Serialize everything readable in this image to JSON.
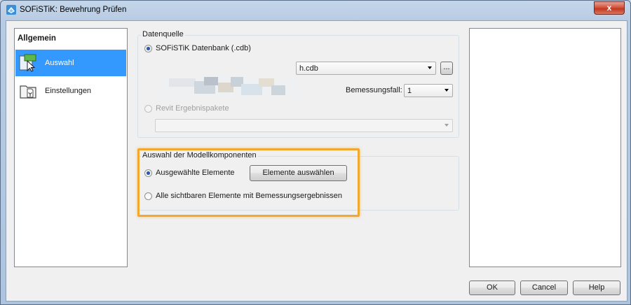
{
  "window": {
    "title": "SOFiSTiK: Bewehrung Prüfen",
    "close_label": "x"
  },
  "nav": {
    "header": "Allgemein",
    "items": [
      {
        "label": "Auswahl",
        "selected": true,
        "icon": "selection-icon"
      },
      {
        "label": "Einstellungen",
        "selected": false,
        "icon": "settings-folder-icon"
      }
    ]
  },
  "datasource": {
    "group_title": "Datenquelle",
    "option_cdb": "SOFiSTiK Datenbank (.cdb)",
    "cdb_file_value": "h.cdb",
    "browse_label": "...",
    "design_case_label": "Bemessungsfall:",
    "design_case_value": "1",
    "option_revit": "Revit Ergebnispakete",
    "revit_value": ""
  },
  "selection": {
    "group_title": "Auswahl der Modellkomponenten",
    "option_selected": "Ausgewählte Elemente",
    "select_button": "Elemente auswählen",
    "option_all": "Alle sichtbaren Elemente mit Bemessungsergebnissen"
  },
  "footer": {
    "ok": "OK",
    "cancel": "Cancel",
    "help": "Help"
  },
  "colors": {
    "accent": "#3399ff",
    "highlight": "#f0a830",
    "close": "#c2371f"
  }
}
